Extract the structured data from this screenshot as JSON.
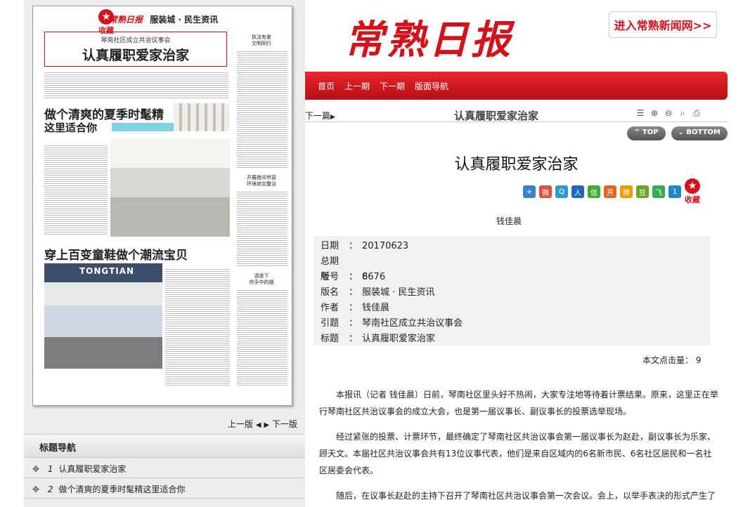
{
  "brand": {
    "name": "常熟日报"
  },
  "header": {
    "enter_label": "进入常熟新闻网>>"
  },
  "nav": {
    "items": [
      "首页",
      "上一期",
      "下一期",
      "版面导航"
    ]
  },
  "newspaper": {
    "favorite_label": "收藏",
    "masthead_logo": "常熟日报",
    "masthead_section": "服装城 · 民生资讯",
    "headline_pre": "琴南社区成立共治议事会",
    "headline_main": "认真履职爱家治家",
    "side_title_1": "执法有爱\n文明同行",
    "side_title_2": "开展夜间市容\n环境综合整治",
    "side_title_3": "请放下\n你手中的烟",
    "section_title_1": "做个清爽的夏季时髦精",
    "section_sub_1": "这里适合你",
    "section_title_2": "穿上百变童鞋做个潮流宝贝",
    "photo_brand": "TONGTIAN"
  },
  "page_nav": {
    "prev": "上一版",
    "next": "下一版"
  },
  "toc": {
    "header": "标题导航",
    "items": [
      {
        "num": "1",
        "title": "认真履职爱家治家"
      },
      {
        "num": "2",
        "title": "做个清爽的夏季时髦精这里适合你"
      }
    ]
  },
  "article": {
    "next_label": "下一篇",
    "bar_title": "认真履职爱家治家",
    "top_label": "TOP",
    "bottom_label": "BOTTOM",
    "title": "认真履职爱家治家",
    "favorite_label": "收藏",
    "author": "钱佳晨",
    "meta": [
      {
        "k": "日期",
        "v": "20170623"
      },
      {
        "k": "总期号",
        "v": "8676"
      },
      {
        "k": "版号",
        "v": "6"
      },
      {
        "k": "版名",
        "v": "服装城 · 民生资讯"
      },
      {
        "k": "作者",
        "v": "钱佳晨"
      },
      {
        "k": "引题",
        "v": "琴南社区成立共治议事会"
      },
      {
        "k": "标题",
        "v": "认真履职爱家治家"
      }
    ],
    "clicks_label": "本文点击量：",
    "clicks_value": "9",
    "paragraphs": [
      "本报讯（记者 钱佳晨）日前，琴南社区里头好不热闹，大家专注地等待着计票结果。原来，这里正在举行琴南社区共治议事会的成立大会，也是第一届议事长、副议事长的投票选举现场。",
      "经过紧张的投票、计票环节，最终确定了琴南社区共治议事会第一届议事长为赵赴，副议事长为乐家、顾天文。本届社区共治议事会共有13位议事代表，他们是来自区域内的6名新市民、6名社区居民和一名社区居委会代表。",
      "随后，在议事长赵赴的主持下召开了琴南社区共治议事会第一次会议。会上，以举手表决的形式产生了第一任秘书长——陆晨，并且确定了议事会的章程及制度。"
    ]
  },
  "colors": {
    "brand_red": "#d3121b",
    "nav_red": "#c8171e"
  }
}
